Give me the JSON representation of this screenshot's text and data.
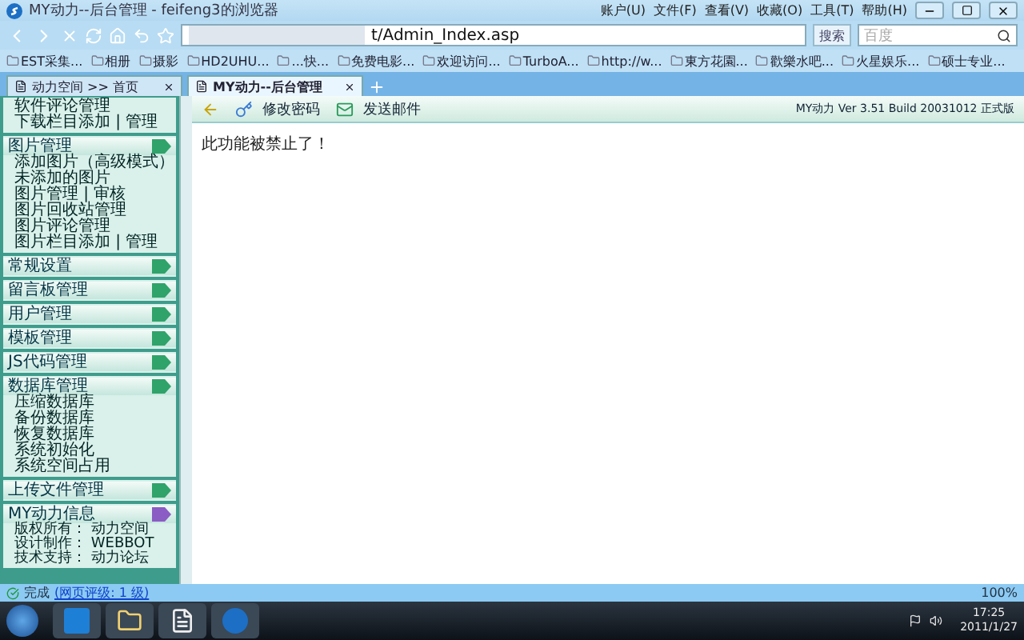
{
  "window": {
    "title": "MY动力--后台管理 - feifeng3的浏览器"
  },
  "menu": [
    "账户(U)",
    "文件(F)",
    "查看(V)",
    "收藏(O)",
    "工具(T)",
    "帮助(H)"
  ],
  "address": {
    "value": "t/Admin_Index.asp"
  },
  "go_label": "搜索",
  "search": {
    "placeholder": "百度"
  },
  "bookmarks": [
    "EST采集...",
    "相册",
    "摄影",
    "HD2UHU...",
    "...快...",
    "免费电影...",
    "欢迎访问...",
    "TurboA...",
    "http://w...",
    "東方花園...",
    "歡樂水吧...",
    "火星娱乐...",
    "硕士专业..."
  ],
  "tabs": [
    {
      "label": "动力空间 >> 首页",
      "selected": false
    },
    {
      "label": "MY动力--后台管理",
      "selected": true
    }
  ],
  "sidebar": [
    {
      "kind": "links",
      "items": [
        "软件评论管理",
        "下载栏目添加 | 管理"
      ]
    },
    {
      "kind": "menu",
      "title": "图片管理",
      "items": [
        "添加图片（高级模式）",
        "未添加的图片",
        "图片管理 | 审核",
        "图片回收站管理",
        "图片评论管理",
        "图片栏目添加 | 管理"
      ]
    },
    {
      "kind": "menu",
      "title": "常规设置"
    },
    {
      "kind": "menu",
      "title": "留言板管理"
    },
    {
      "kind": "menu",
      "title": "用户管理"
    },
    {
      "kind": "menu",
      "title": "模板管理"
    },
    {
      "kind": "menu",
      "title": "JS代码管理"
    },
    {
      "kind": "menu",
      "title": "数据库管理",
      "items": [
        "压缩数据库",
        "备份数据库",
        "恢复数据库",
        "系统初始化",
        "系统空间占用"
      ]
    },
    {
      "kind": "menu",
      "title": "上传文件管理"
    },
    {
      "kind": "info",
      "title": "MY动力信息",
      "items": [
        "版权所有： 动力空间",
        "设计制作： WEBBOT",
        "技术支持： 动力论坛"
      ]
    }
  ],
  "toolbar": {
    "actions": [
      "修改密码",
      "发送邮件"
    ],
    "version": "MY动力 Ver 3.51 Build 20031012 正式版"
  },
  "message": "此功能被禁止了！",
  "status": {
    "text": "完成",
    "rating": "(网页评级: 1 级)",
    "zoom": "100%"
  },
  "clock": {
    "time": "17:25",
    "date": "2011/1/27"
  }
}
